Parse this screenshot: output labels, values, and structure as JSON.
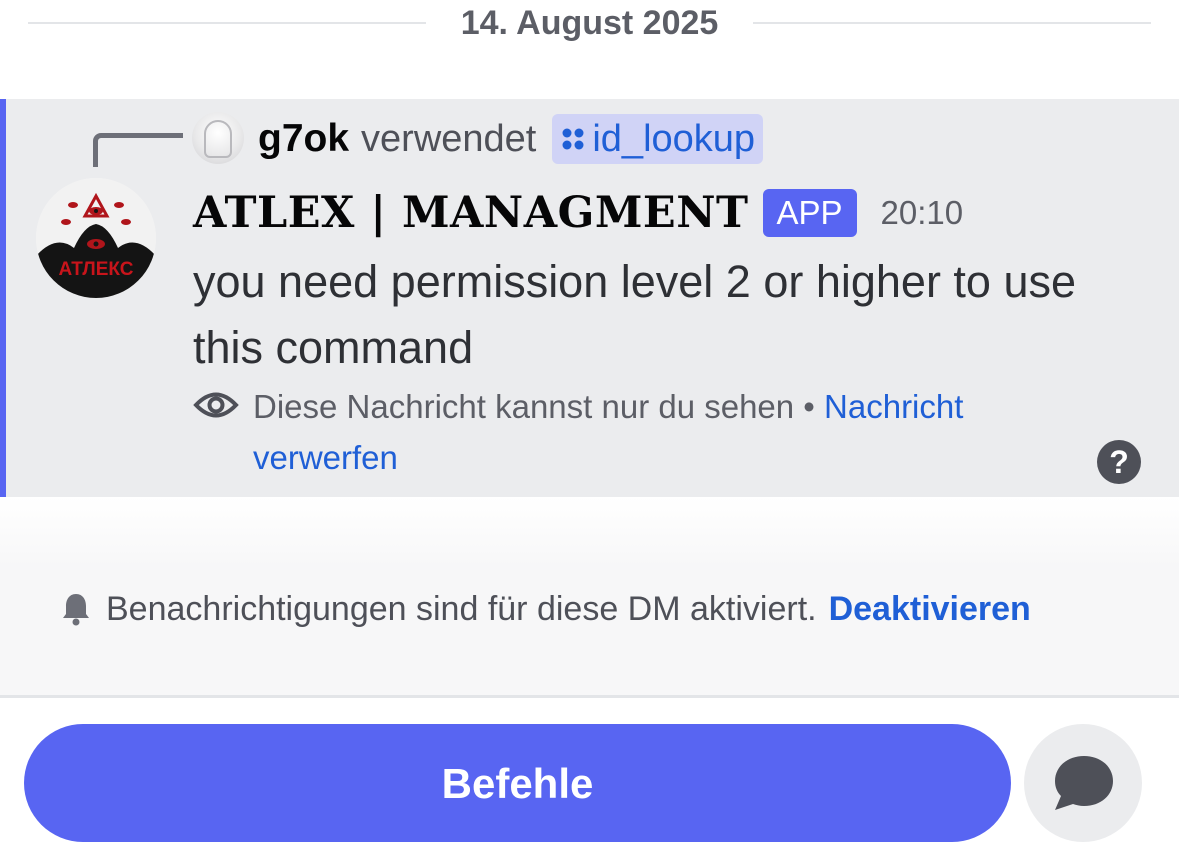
{
  "date_divider": {
    "label": "14. August 2025"
  },
  "message": {
    "reply": {
      "username": "g7ok",
      "verb": "verwendet",
      "command": "id_lookup"
    },
    "author": {
      "name": "ATLEX | MANAGMENT",
      "badge": "APP",
      "avatar_text": "АТЛЕКС"
    },
    "timestamp": "20:10",
    "text": "you need permission level 2 or higher to use this command",
    "ephemeral": {
      "notice": "Diese Nachricht kannst nur du sehen •",
      "dismiss_part1": "Nachricht",
      "dismiss_part2": "verwerfen",
      "help": "?"
    }
  },
  "notification_banner": {
    "text": "Benachrichtigungen sind für diese DM aktiviert.",
    "action": "Deaktivieren"
  },
  "bottom_bar": {
    "commands_label": "Befehle"
  },
  "icons": {
    "reply_avatar": "user-avatar",
    "command": "app-command-icon",
    "eye": "eye-icon",
    "help": "help-icon",
    "bell": "bell-icon",
    "chat": "chat-bubble-icon"
  },
  "colors": {
    "accent": "#5865f2",
    "link": "#1f5fd6",
    "ephemeral_bg": "#ebecee"
  }
}
